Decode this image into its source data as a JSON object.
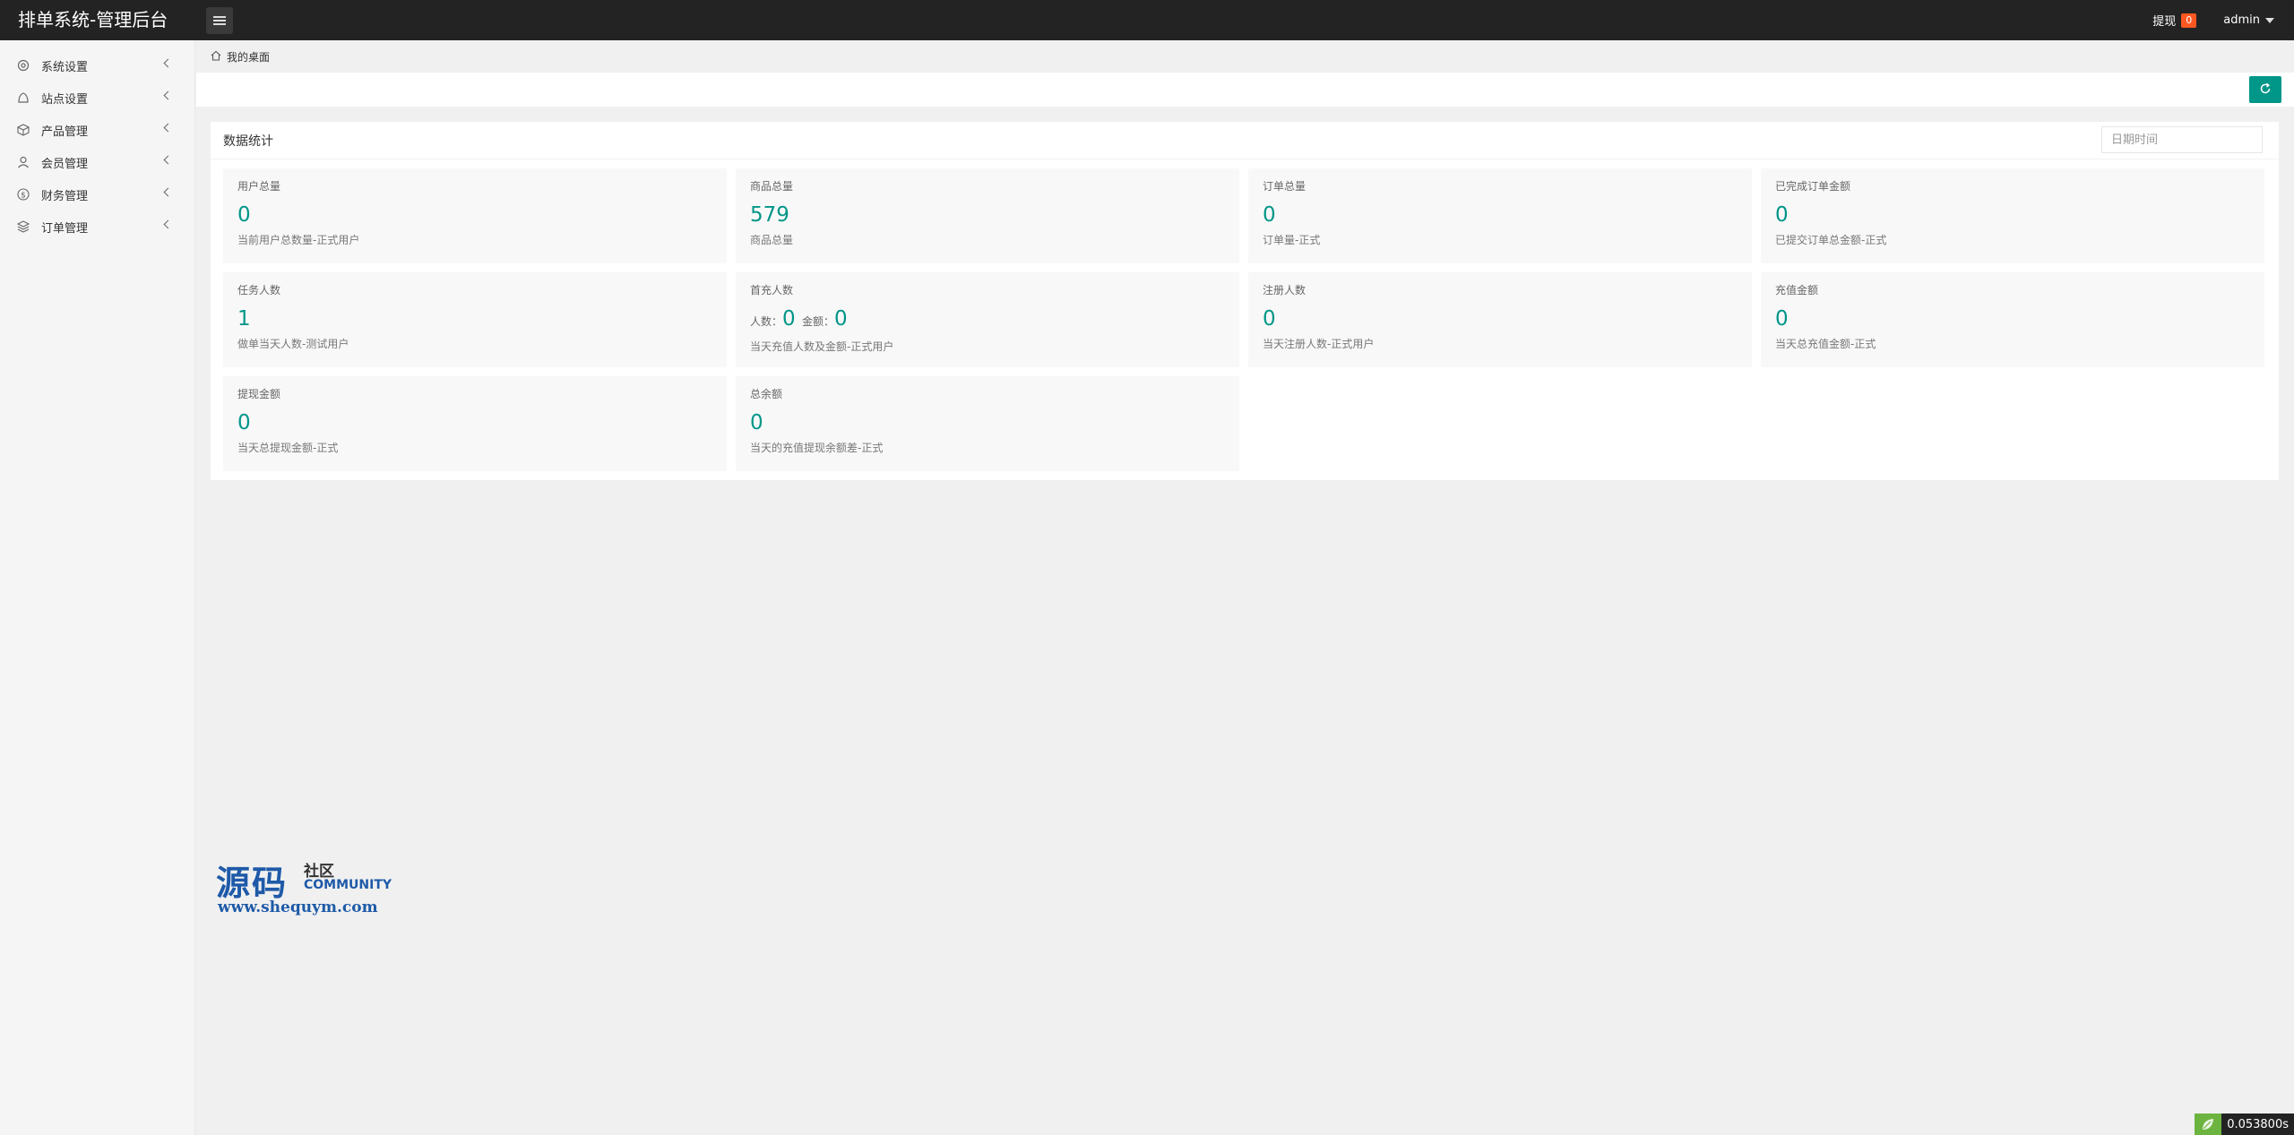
{
  "header": {
    "brand": "排单系统-管理后台",
    "withdraw_label": "提现",
    "withdraw_count": "0",
    "user": "admin"
  },
  "sidebar": {
    "items": [
      {
        "label": "系统设置",
        "icon": "gear-icon"
      },
      {
        "label": "站点设置",
        "icon": "site-icon"
      },
      {
        "label": "产品管理",
        "icon": "box-icon"
      },
      {
        "label": "会员管理",
        "icon": "user-icon"
      },
      {
        "label": "财务管理",
        "icon": "dollar-icon"
      },
      {
        "label": "订单管理",
        "icon": "layers-icon"
      }
    ]
  },
  "breadcrumb": {
    "label": "我的桌面"
  },
  "stats": {
    "title": "数据统计",
    "date_placeholder": "日期时间",
    "cards": [
      {
        "title": "用户总量",
        "value": "0",
        "desc": "当前用户总数量-正式用户"
      },
      {
        "title": "商品总量",
        "value": "579",
        "desc": "商品总量"
      },
      {
        "title": "订单总量",
        "value": "0",
        "desc": "订单量-正式"
      },
      {
        "title": "已完成订单金额",
        "value": "0",
        "desc": "已提交订单总金额-正式"
      },
      {
        "title": "任务人数",
        "value": "1",
        "desc": "做单当天人数-测试用户"
      },
      {
        "title": "首充人数",
        "count_label": "人数：",
        "count_value": "0",
        "amount_label": "金额：",
        "amount_value": "0",
        "desc": "当天充值人数及金额-正式用户"
      },
      {
        "title": "注册人数",
        "value": "0",
        "desc": "当天注册人数-正式用户"
      },
      {
        "title": "充值金额",
        "value": "0",
        "desc": "当天总充值金额-正式"
      },
      {
        "title": "提现金额",
        "value": "0",
        "desc": "当天总提现金额-正式"
      },
      {
        "title": "总余额",
        "value": "0",
        "desc": "当天的充值提现余额差-正式"
      }
    ]
  },
  "watermark": {
    "big": "源码",
    "small1": "社区",
    "small2": "COMMUNITY",
    "url": "www.shequym.com"
  },
  "timer": {
    "value": "0.053800s"
  },
  "colors": {
    "accent": "#009688",
    "header_bg": "#232323",
    "badge": "#ff5722"
  }
}
